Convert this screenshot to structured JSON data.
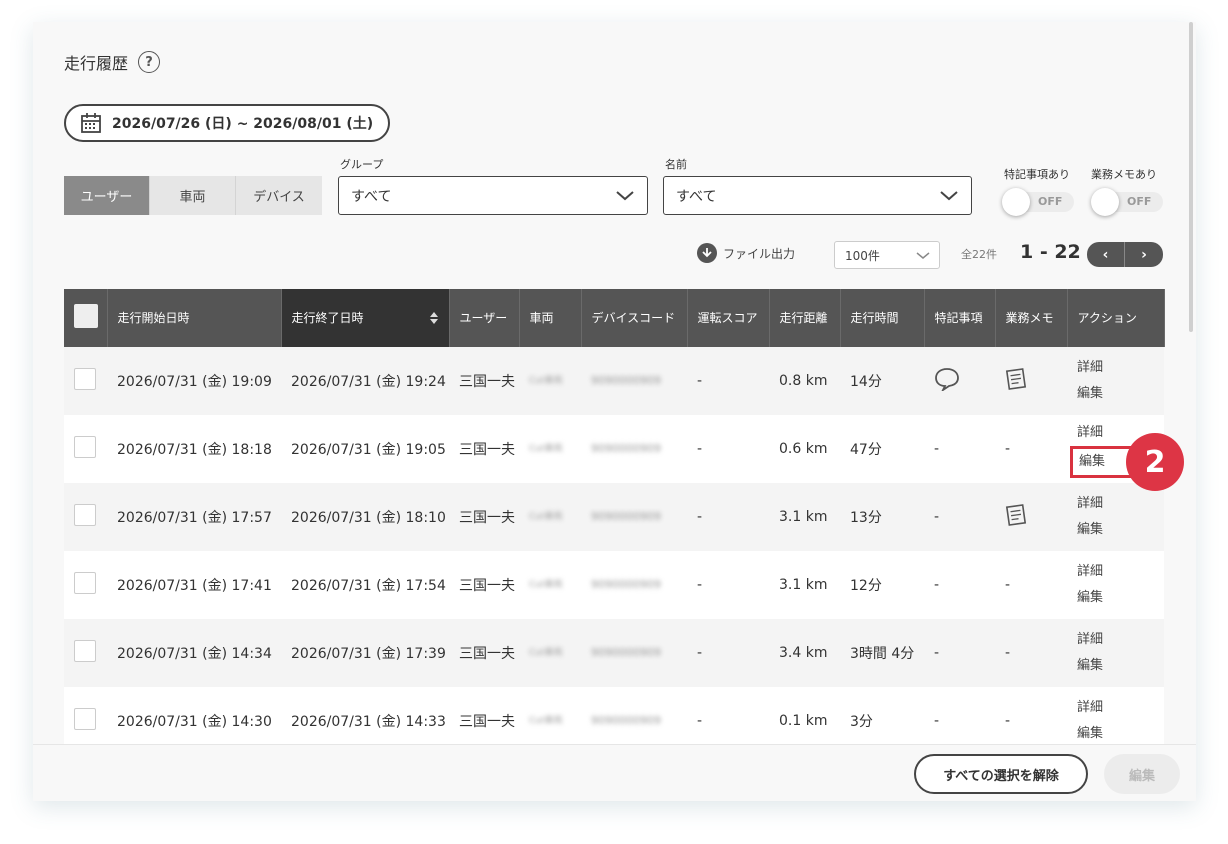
{
  "header": {
    "title": "走行履歴",
    "help_icon": "question-circle-icon"
  },
  "date_range": {
    "label": "2026/07/26 (日) ~ 2026/08/01 (土)",
    "icon": "calendar-icon"
  },
  "segment": {
    "tabs": [
      {
        "label": "ユーザー",
        "active": true
      },
      {
        "label": "車両",
        "active": false
      },
      {
        "label": "デバイス",
        "active": false
      }
    ]
  },
  "filters": {
    "group": {
      "label": "グループ",
      "value": "すべて"
    },
    "name": {
      "label": "名前",
      "value": "すべて"
    }
  },
  "toggles": [
    {
      "label": "特記事項あり",
      "state": "OFF"
    },
    {
      "label": "業務メモあり",
      "state": "OFF"
    }
  ],
  "toolbar": {
    "export_label": "ファイル出力",
    "per_page": "100件",
    "total": "全22件",
    "range": "1 - 22",
    "prev": "‹",
    "next": "›"
  },
  "table": {
    "columns": [
      "走行開始日時",
      "走行終了日時",
      "ユーザー",
      "車両",
      "デバイスコード",
      "運転スコア",
      "走行距離",
      "走行時間",
      "特記事項",
      "業務メモ",
      "アクション"
    ],
    "rows": [
      {
        "start": "2026/07/31 (金) 19:09",
        "end": "2026/07/31 (金) 19:24",
        "user": "三国一夫",
        "vehicle": "Cut車両",
        "device": "9090000909",
        "score": "-",
        "distance": "0.8 km",
        "duration": "14分",
        "note": "comment-icon",
        "memo": "memo-icon",
        "detail": "詳細",
        "edit": "編集"
      },
      {
        "start": "2026/07/31 (金) 18:18",
        "end": "2026/07/31 (金) 19:05",
        "user": "三国一夫",
        "vehicle": "Cut車両",
        "device": "9090000909",
        "score": "-",
        "distance": "0.6 km",
        "duration": "47分",
        "note": "-",
        "memo": "-",
        "detail": "詳細",
        "edit": "編集"
      },
      {
        "start": "2026/07/31 (金) 17:57",
        "end": "2026/07/31 (金) 18:10",
        "user": "三国一夫",
        "vehicle": "Cut車両",
        "device": "9090000909",
        "score": "-",
        "distance": "3.1 km",
        "duration": "13分",
        "note": "-",
        "memo": "memo-icon",
        "detail": "詳細",
        "edit": "編集"
      },
      {
        "start": "2026/07/31 (金) 17:41",
        "end": "2026/07/31 (金) 17:54",
        "user": "三国一夫",
        "vehicle": "Cut車両",
        "device": "9090000909",
        "score": "-",
        "distance": "3.1 km",
        "duration": "12分",
        "note": "-",
        "memo": "-",
        "detail": "詳細",
        "edit": "編集"
      },
      {
        "start": "2026/07/31 (金) 14:34",
        "end": "2026/07/31 (金) 17:39",
        "user": "三国一夫",
        "vehicle": "Cut車両",
        "device": "9090000909",
        "score": "-",
        "distance": "3.4 km",
        "duration": "3時間 4分",
        "note": "-",
        "memo": "-",
        "detail": "詳細",
        "edit": "編集"
      },
      {
        "start": "2026/07/31 (金) 14:30",
        "end": "2026/07/31 (金) 14:33",
        "user": "三国一夫",
        "vehicle": "Cut車両",
        "device": "9090000909",
        "score": "-",
        "distance": "0.1 km",
        "duration": "3分",
        "note": "-",
        "memo": "-",
        "detail": "詳細",
        "edit": "編集"
      }
    ]
  },
  "callout": {
    "number": "2",
    "color": "#dd3545"
  },
  "footer": {
    "clear_label": "すべての選択を解除",
    "edit_label": "編集"
  }
}
